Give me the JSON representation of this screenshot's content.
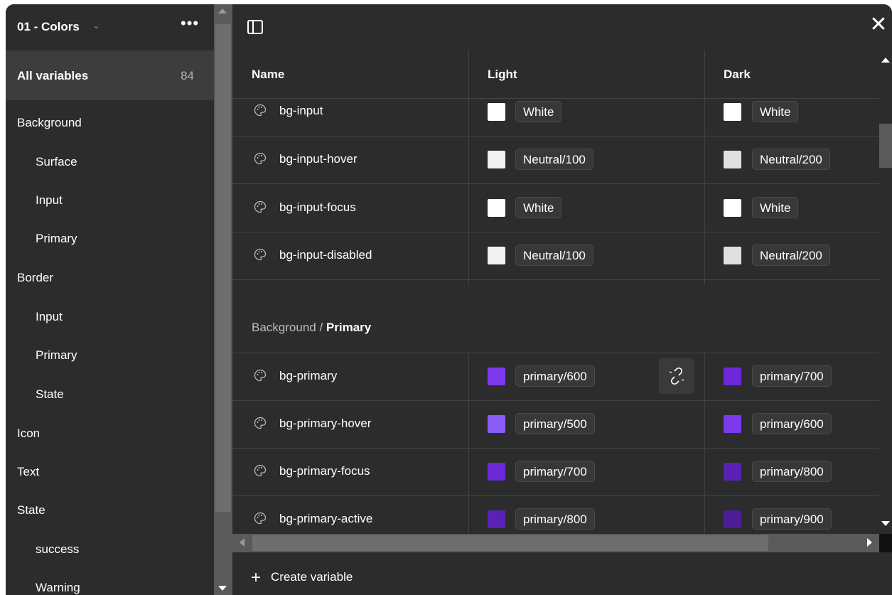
{
  "sidebar": {
    "collection": "01 - Colors",
    "all_label": "All variables",
    "all_count": "84",
    "items": [
      "Background",
      "Surface",
      "Input",
      "Primary",
      "Border",
      "Input",
      "Primary",
      "State",
      "Icon",
      "Text",
      "State",
      "success",
      "Warning"
    ]
  },
  "table": {
    "headers": {
      "name": "Name",
      "light": "Light",
      "dark": "Dark"
    },
    "rows_top": [
      {
        "name": "bg-input",
        "light": "White",
        "light_color": "#ffffff",
        "dark": "White",
        "dark_color": "#ffffff"
      },
      {
        "name": "bg-input-hover",
        "light": "Neutral/100",
        "light_color": "#f2f2f2",
        "dark": "Neutral/200",
        "dark_color": "#e0e0e0"
      },
      {
        "name": "bg-input-focus",
        "light": "White",
        "light_color": "#ffffff",
        "dark": "White",
        "dark_color": "#ffffff"
      },
      {
        "name": "bg-input-disabled",
        "light": "Neutral/100",
        "light_color": "#f2f2f2",
        "dark": "Neutral/200",
        "dark_color": "#e0e0e0"
      }
    ],
    "group": {
      "parent": "Background /",
      "child": "Primary"
    },
    "rows_bottom": [
      {
        "name": "bg-primary",
        "light": "primary/600",
        "light_color": "#7c3aed",
        "dark": "primary/700",
        "dark_color": "#6d28d9"
      },
      {
        "name": "bg-primary-hover",
        "light": "primary/500",
        "light_color": "#8b5cf6",
        "dark": "primary/600",
        "dark_color": "#7c3aed"
      },
      {
        "name": "bg-primary-focus",
        "light": "primary/700",
        "light_color": "#6d28d9",
        "dark": "primary/800",
        "dark_color": "#5b21b6"
      },
      {
        "name": "bg-primary-active",
        "light": "primary/800",
        "light_color": "#5b21b6",
        "dark": "primary/900",
        "dark_color": "#4c1d95"
      }
    ]
  },
  "footer": {
    "create_label": "Create variable"
  },
  "icons": {
    "panel": "sidebar-toggle-icon",
    "close": "close-icon",
    "palette": "palette-icon",
    "unlink": "unlink-icon",
    "more": "more-icon"
  }
}
